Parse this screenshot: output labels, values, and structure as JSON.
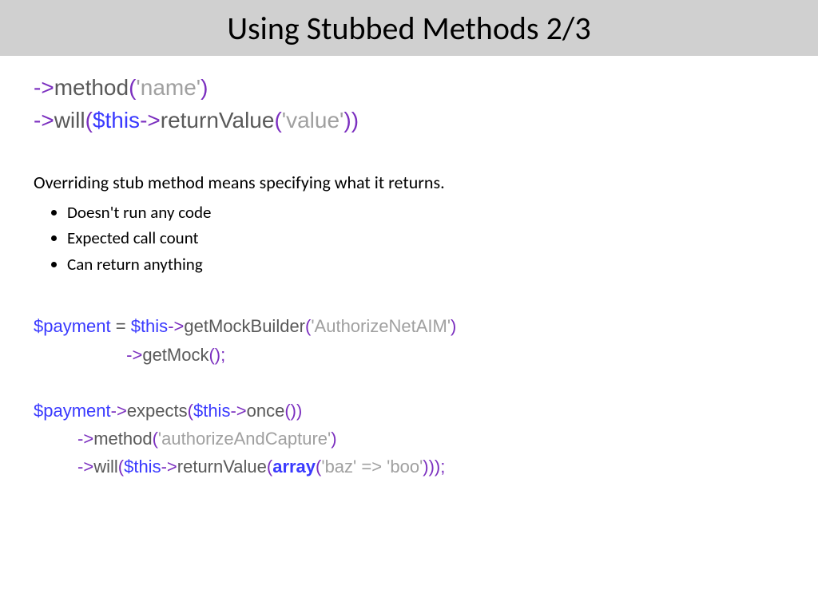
{
  "title": "Using Stubbed Methods 2/3",
  "topcode": {
    "l1": {
      "arrow": "->",
      "method": "method",
      "p1": "(",
      "str": "'name'",
      "p2": ")"
    },
    "l2": {
      "arrow": "->",
      "will": "will",
      "p1": "(",
      "thiskw": "$this",
      "arrow2": "->",
      "rv": "returnValue",
      "p2": "(",
      "str": "'value'",
      "p3": "))"
    }
  },
  "explain": "Overriding stub method means specifying what it returns.",
  "bullets": [
    "Doesn't run any code",
    "Expected call count",
    "Can return anything"
  ],
  "code2": {
    "l1": {
      "payment": "$payment",
      "eq": " = ",
      "this": "$this",
      "arrow": "->",
      "gmb": "getMockBuilder",
      "p1": "(",
      "str": "'AuthorizeNetAIM'",
      "p2": ")"
    },
    "l2": {
      "indent": "                   ",
      "arrow": "->",
      "gm": "getMock",
      "p": "();"
    },
    "l3": "",
    "l4": {
      "payment": "$payment",
      "arrow": "->",
      "expects": "expects",
      "p1": "(",
      "this": "$this",
      "arrow2": "->",
      "once": "once",
      "p2": "())"
    },
    "l5": {
      "indent": "         ",
      "arrow": "->",
      "method": "method",
      "p1": "(",
      "str": "'authorizeAndCapture'",
      "p2": ")"
    },
    "l6": {
      "indent": "         ",
      "arrow": "->",
      "will": "will",
      "p1": "(",
      "this": "$this",
      "arrow2": "->",
      "rv": "returnValue",
      "p2": "(",
      "kw": "array",
      "p3": "(",
      "str1": "'baz'",
      "fat": " => ",
      "str2": "'boo'",
      "p4": ")));"
    }
  }
}
